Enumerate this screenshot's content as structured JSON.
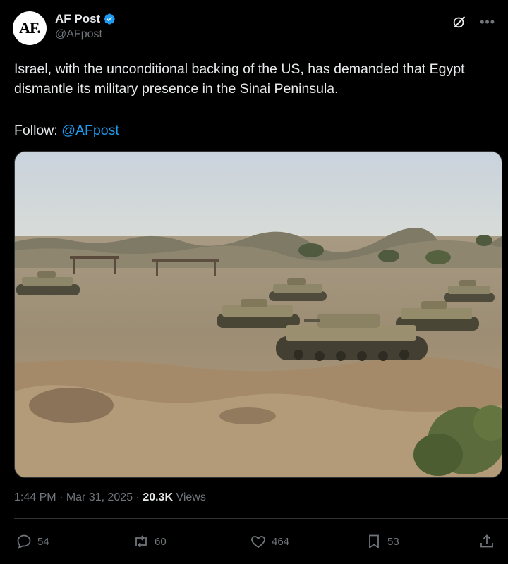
{
  "author": {
    "avatar_text": "AF.",
    "display_name": "AF Post",
    "handle": "@AFpost",
    "verified": true,
    "verified_color": "#1d9bf0"
  },
  "tweet": {
    "text": "Israel, with the unconditional backing of the US, has demanded that Egypt dismantle its military presence in the Sinai Peninsula.",
    "follow_prefix": "Follow: ",
    "follow_mention": "@AFpost",
    "mention_color": "#1d9bf0"
  },
  "meta": {
    "time": "1:44 PM",
    "separator1": " · ",
    "date": "Mar 31, 2025",
    "separator2": " · ",
    "views_count": "20.3K",
    "views_label": " Views"
  },
  "actions": {
    "replies": "54",
    "reposts": "60",
    "likes": "464",
    "bookmarks": "53"
  },
  "icons": {
    "verified": "verified-badge-icon",
    "grok": "grok-icon",
    "more": "more-icon",
    "reply": "reply-icon",
    "repost": "repost-icon",
    "like": "heart-icon",
    "bookmark": "bookmark-icon",
    "share": "share-icon"
  }
}
